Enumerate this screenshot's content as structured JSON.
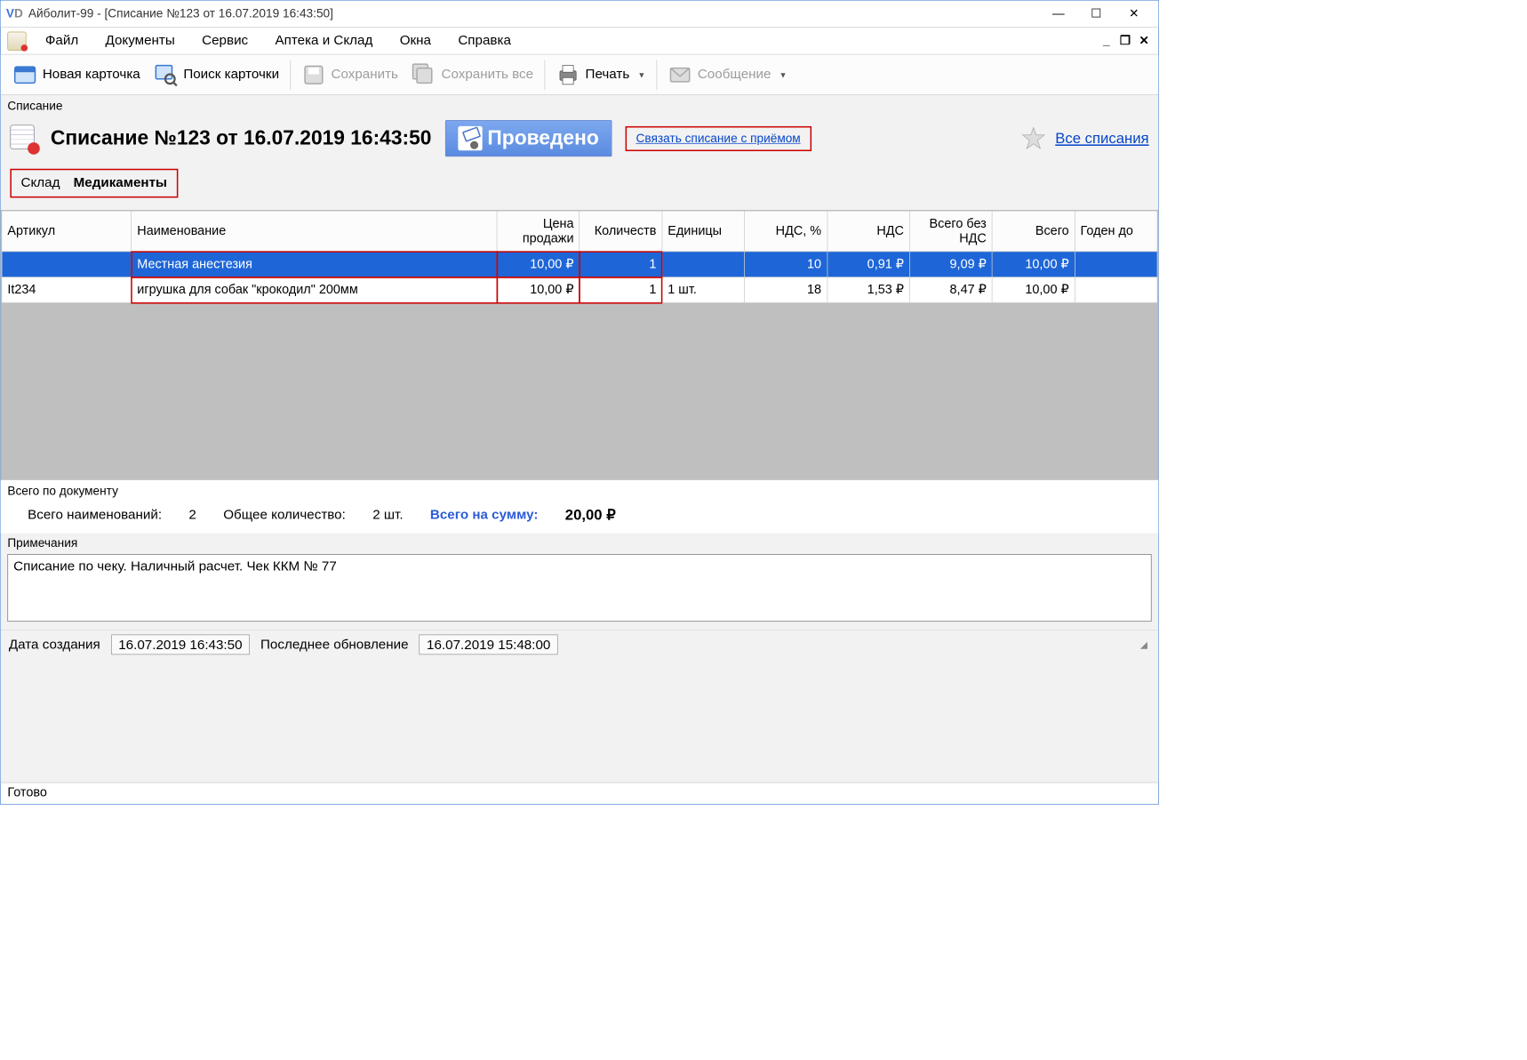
{
  "window": {
    "logo_v": "V",
    "logo_d": "D",
    "title": "Айболит-99 - [Списание №123 от 16.07.2019 16:43:50]"
  },
  "menu": {
    "items": [
      "Файл",
      "Документы",
      "Сервис",
      "Аптека и Склад",
      "Окна",
      "Справка"
    ]
  },
  "toolbar": {
    "new_card": "Новая карточка",
    "search_card": "Поиск карточки",
    "save": "Сохранить",
    "save_all": "Сохранить все",
    "print": "Печать",
    "message": "Сообщение"
  },
  "panel": {
    "caption": "Списание",
    "title": "Списание №123 от 16.07.2019 16:43:50",
    "status": "Проведено",
    "link": "Связать списание с приёмом",
    "all_link": "Все списания"
  },
  "warehouse": {
    "label": "Склад",
    "value": "Медикаменты"
  },
  "table": {
    "headers": {
      "article": "Артикул",
      "name": "Наименование",
      "price": "Цена продажи",
      "qty": "Количеств",
      "unit": "Единицы",
      "vat_pct": "НДС, %",
      "vat": "НДС",
      "total_no_vat": "Всего без НДС",
      "total": "Всего",
      "expiry": "Годен до"
    },
    "rows": [
      {
        "article": "",
        "name": "Местная анестезия",
        "price": "10,00 ₽",
        "qty": "1",
        "unit": "",
        "vat_pct": "10",
        "vat": "0,91 ₽",
        "total_no_vat": "9,09 ₽",
        "total": "10,00 ₽",
        "expiry": "",
        "selected": true
      },
      {
        "article": "It234",
        "name": "игрушка для собак \"крокодил\" 200мм",
        "price": "10,00 ₽",
        "qty": "1",
        "unit": "1 шт.",
        "vat_pct": "18",
        "vat": "1,53 ₽",
        "total_no_vat": "8,47 ₽",
        "total": "10,00 ₽",
        "expiry": "",
        "selected": false
      }
    ]
  },
  "totals": {
    "caption": "Всего по документу",
    "names_label": "Всего наименований:",
    "names_value": "2",
    "qty_label": "Общее количество:",
    "qty_value": "2 шт.",
    "sum_label": "Всего на сумму:",
    "sum_value": "20,00 ₽"
  },
  "notes": {
    "caption": "Примечания",
    "text": "Списание по чеку. Наличный расчет. Чек ККМ № 77"
  },
  "dates": {
    "created_label": "Дата создания",
    "created_value": "16.07.2019 16:43:50",
    "updated_label": "Последнее обновление",
    "updated_value": "16.07.2019 15:48:00"
  },
  "statusbar": {
    "text": "Готово"
  }
}
